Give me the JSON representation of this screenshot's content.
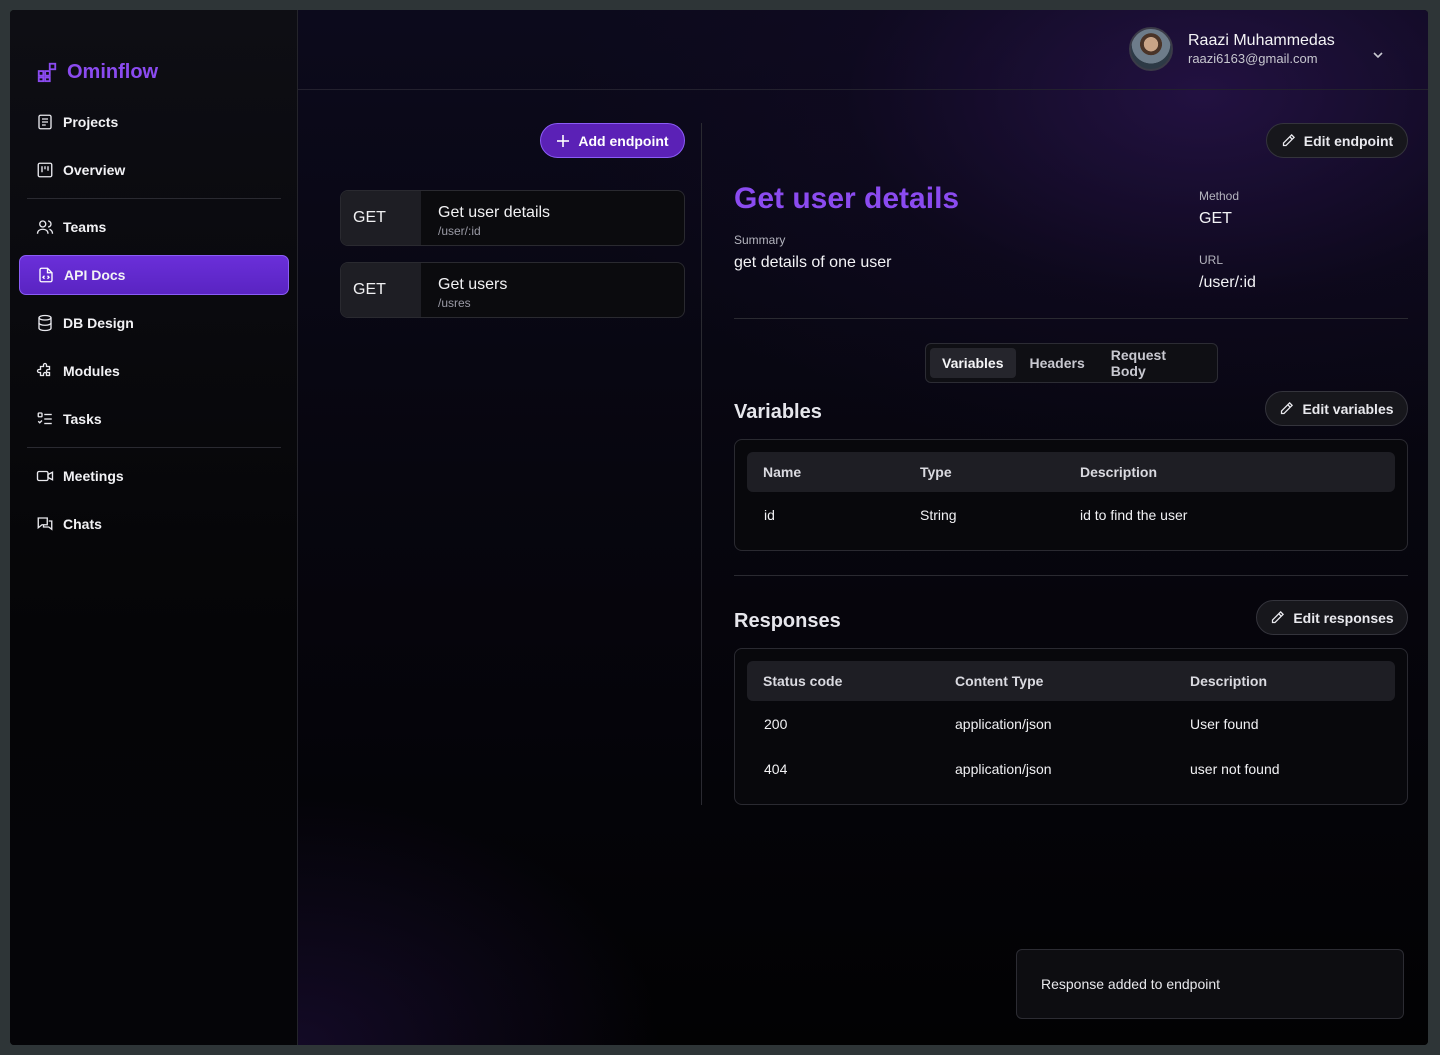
{
  "app": {
    "name": "Ominflow",
    "accent": "#8b4bf0"
  },
  "nav": {
    "group1": [
      {
        "label": "Projects",
        "icon": "file-text-icon"
      },
      {
        "label": "Overview",
        "icon": "kanban-icon"
      }
    ],
    "group2": [
      {
        "label": "Teams",
        "icon": "users-icon"
      },
      {
        "label": "API Docs",
        "icon": "file-code-icon",
        "active": true
      },
      {
        "label": "DB Design",
        "icon": "database-icon"
      },
      {
        "label": "Modules",
        "icon": "puzzle-icon"
      },
      {
        "label": "Tasks",
        "icon": "list-checks-icon"
      }
    ],
    "group3": [
      {
        "label": "Meetings",
        "icon": "video-icon"
      },
      {
        "label": "Chats",
        "icon": "messages-icon"
      }
    ]
  },
  "user": {
    "name": "Raazi Muhammedas",
    "email": "raazi6163@gmail.com"
  },
  "endpoints": {
    "add_label": "Add endpoint",
    "items": [
      {
        "method": "GET",
        "name": "Get user details",
        "path": "/user/:id"
      },
      {
        "method": "GET",
        "name": "Get users",
        "path": "/usres"
      }
    ]
  },
  "detail": {
    "edit_endpoint_label": "Edit endpoint",
    "title": "Get user details",
    "summary_label": "Summary",
    "summary": "get details of one user",
    "method_label": "Method",
    "method": "GET",
    "url_label": "URL",
    "url": "/user/:id",
    "tabs": [
      {
        "label": "Variables",
        "active": true
      },
      {
        "label": "Headers"
      },
      {
        "label": "Request Body"
      }
    ],
    "variables": {
      "title": "Variables",
      "edit_label": "Edit variables",
      "columns": [
        "Name",
        "Type",
        "Description"
      ],
      "rows": [
        [
          "id",
          "String",
          "id to find the user"
        ]
      ]
    },
    "responses": {
      "title": "Responses",
      "edit_label": "Edit responses",
      "columns": [
        "Status code",
        "Content Type",
        "Description"
      ],
      "rows": [
        [
          "200",
          "application/json",
          "User found"
        ],
        [
          "404",
          "application/json",
          "user not found"
        ]
      ]
    }
  },
  "toast": {
    "message": "Response added to endpoint"
  }
}
